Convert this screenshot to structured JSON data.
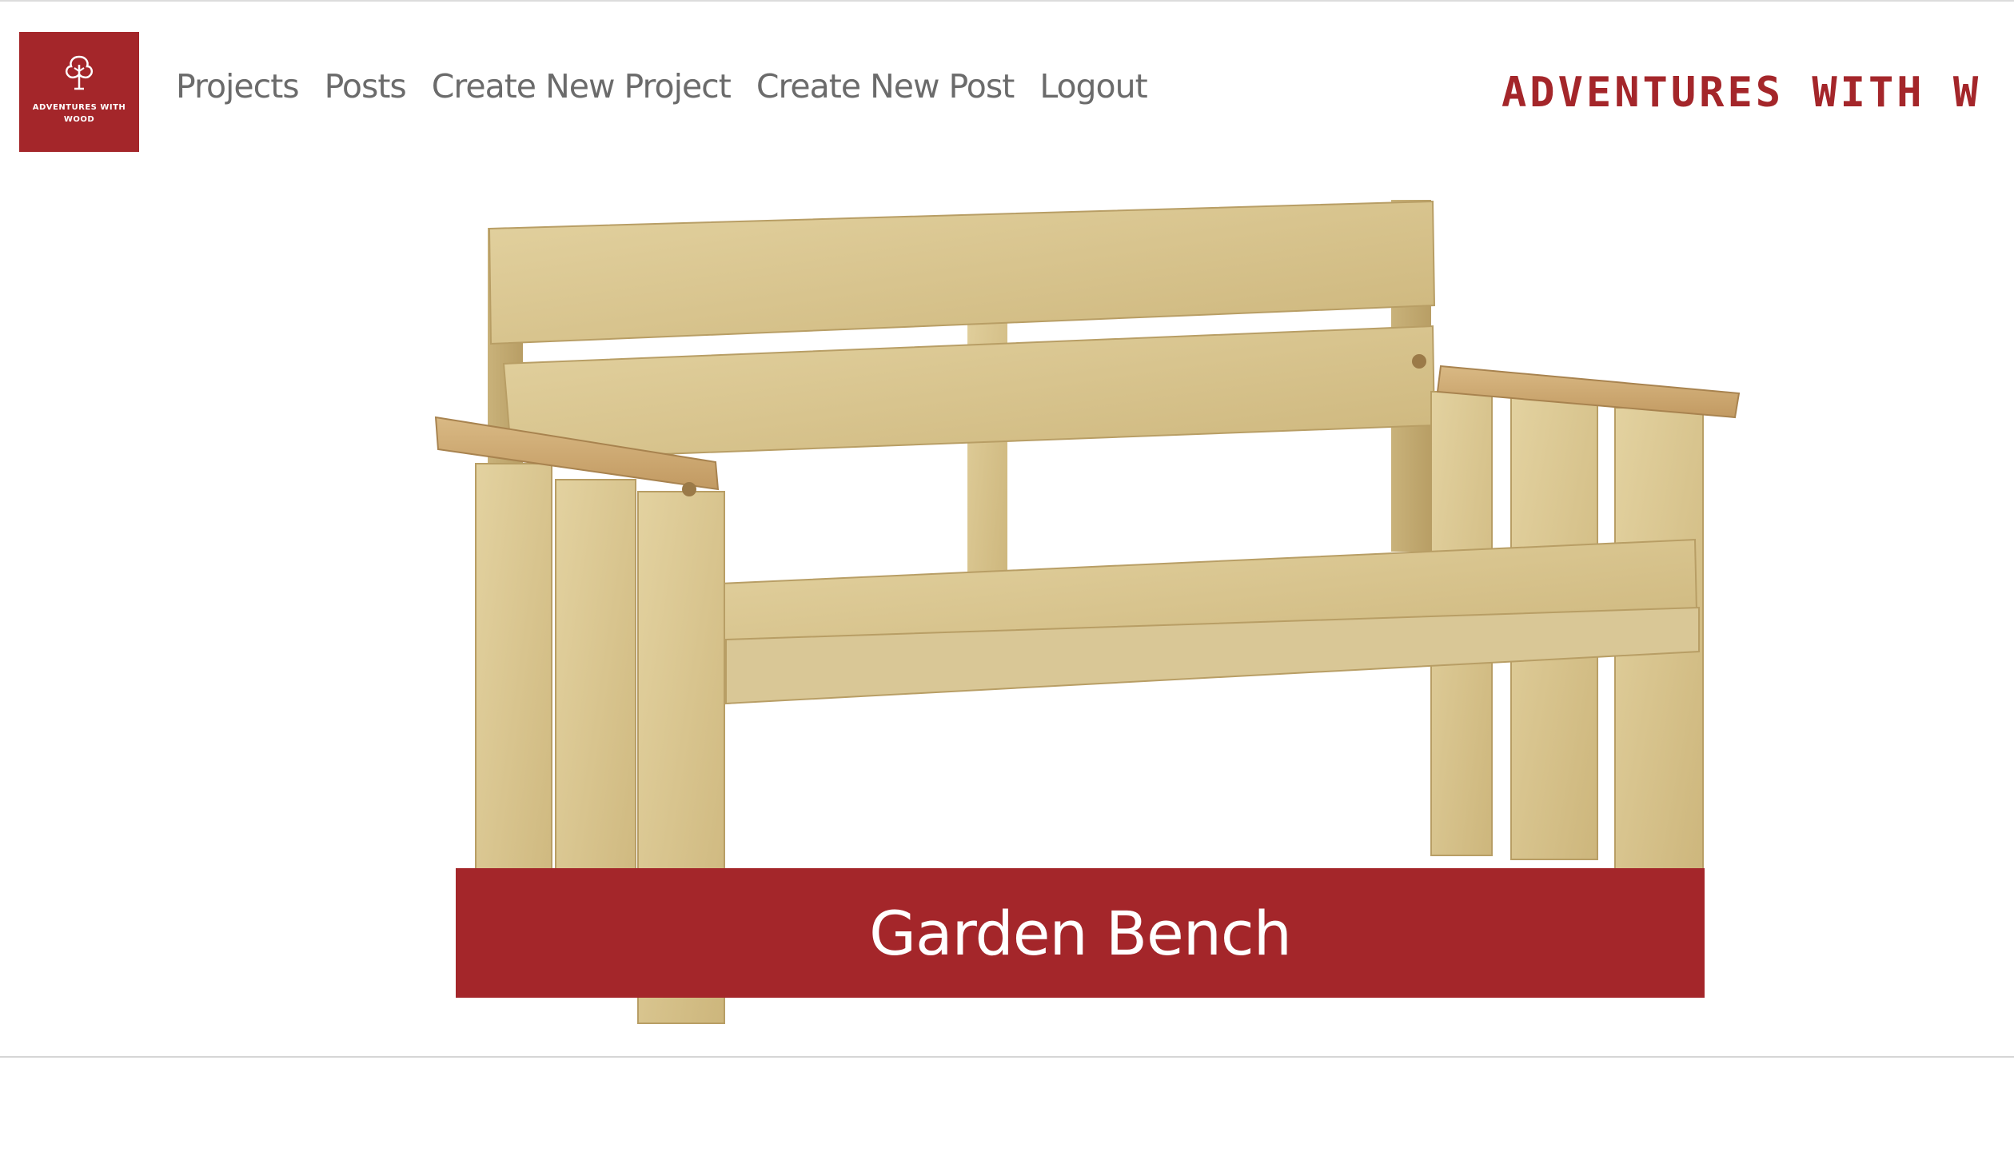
{
  "logo": {
    "icon": "tree-icon",
    "text": "ADVENTURES WITH WOOD"
  },
  "nav": {
    "items": [
      {
        "label": "Projects"
      },
      {
        "label": "Posts"
      },
      {
        "label": "Create New Project"
      },
      {
        "label": "Create New Post"
      },
      {
        "label": "Logout"
      }
    ]
  },
  "brand": {
    "text": "ADVENTURES WITH W"
  },
  "hero": {
    "caption": "Garden Bench"
  },
  "colors": {
    "accent": "#a4262a",
    "nav_text": "#6b6b6b",
    "wood": "#d8c48e"
  }
}
